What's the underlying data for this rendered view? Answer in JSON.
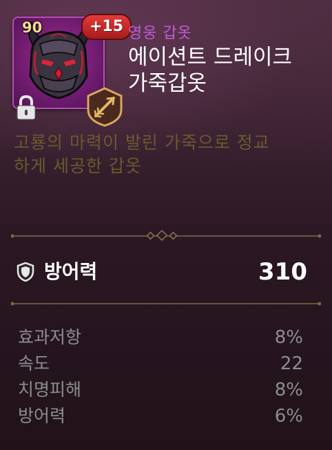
{
  "item": {
    "level": "90",
    "enhancement": "+15",
    "rarity": "영웅 갑옷",
    "name_line1": "에이션트 드레이크",
    "name_line2": "가죽갑옷",
    "description_line1": "고룡의 마력이 발린 가죽으로 정교",
    "description_line2": "하게 세공한 갑옷",
    "locked": true
  },
  "icons": {
    "item_art": "dark-dragon-helmet-armor-icon",
    "lock": "lock-icon",
    "class": "arrow-class-icon",
    "main_stat": "shield-icon"
  },
  "main_stat": {
    "label": "방어력",
    "value": "310"
  },
  "sub_stats": [
    {
      "label": "효과저항",
      "value": "8%"
    },
    {
      "label": "속도",
      "value": "22"
    },
    {
      "label": "치명피해",
      "value": "8%"
    },
    {
      "label": "방어력",
      "value": "6%"
    }
  ],
  "colors": {
    "rarity": "#c25bd7",
    "title": "#ffffff",
    "description": "#6a5a2f",
    "substat": "#8c8c93",
    "enhancement_badge": "#d32f2c",
    "level": "#f1dc8f",
    "icon_background": "#8a2587",
    "divider": "#7d6a45"
  }
}
